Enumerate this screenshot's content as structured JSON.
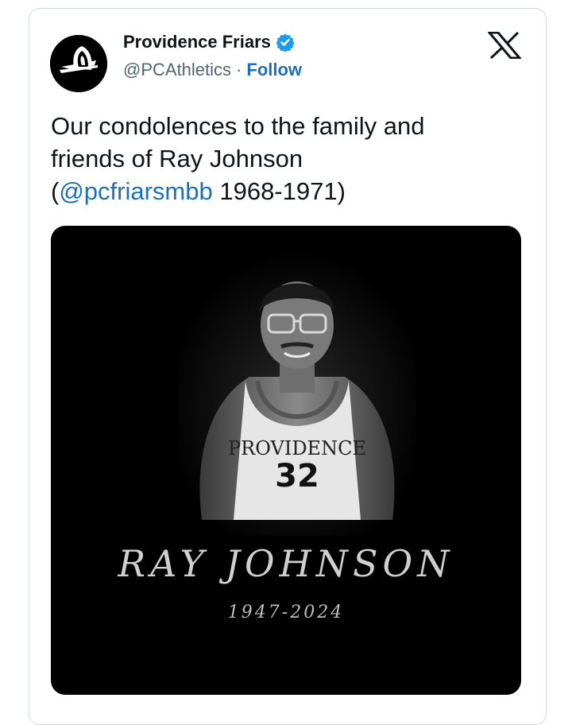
{
  "account": {
    "display_name": "Providence Friars",
    "handle": "@PCAthletics",
    "separator": "·",
    "follow_label": "Follow"
  },
  "tweet": {
    "text_line1": "Our condolences to the family and",
    "text_line2": "friends of Ray Johnson",
    "open_paren": "(",
    "mention": "@pcfriarsmbb",
    "text_tail": " 1968-1971)"
  },
  "media": {
    "jersey_text": "PROVIDENCE",
    "jersey_number": "32",
    "memorial_name": "RAY JOHNSON",
    "memorial_years": "1947-2024"
  },
  "colors": {
    "link": "#1d6fb8",
    "verified": "#1d9bf0",
    "media_bg": "#000000"
  },
  "icons": {
    "verified": "verified-badge-icon",
    "platform": "x-logo-icon"
  }
}
